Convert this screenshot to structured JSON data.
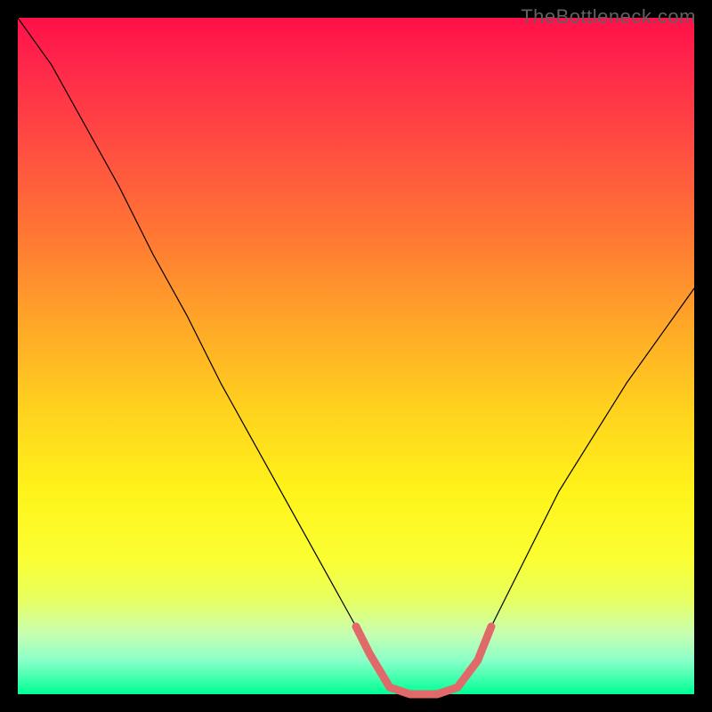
{
  "attribution": "TheBottleneck.com",
  "colors": {
    "frame": "#000000",
    "curve_main": "#000000",
    "curve_valley": "#e06969",
    "gradient_top": "#ff1049",
    "gradient_bottom": "#00ff95"
  },
  "chart_data": {
    "type": "line",
    "title": "",
    "xlabel": "",
    "ylabel": "",
    "xlim": [
      0,
      100
    ],
    "ylim": [
      0,
      100
    ],
    "series": [
      {
        "name": "bottleneck-curve",
        "x": [
          0,
          5,
          10,
          15,
          20,
          25,
          30,
          35,
          40,
          45,
          50,
          52,
          55,
          58,
          60,
          62,
          65,
          68,
          70,
          75,
          80,
          85,
          90,
          95,
          100
        ],
        "y": [
          100,
          93,
          84,
          75,
          65,
          56,
          46,
          37,
          28,
          19,
          10,
          6,
          1,
          0,
          0,
          0,
          1,
          5,
          10,
          20,
          30,
          38,
          46,
          53,
          60
        ]
      }
    ],
    "valley_segment": {
      "name": "valley-highlight",
      "x": [
        50,
        52,
        55,
        58,
        60,
        62,
        65,
        68,
        70
      ],
      "y": [
        10,
        6,
        1,
        0,
        0,
        0,
        1,
        5,
        10
      ]
    }
  }
}
